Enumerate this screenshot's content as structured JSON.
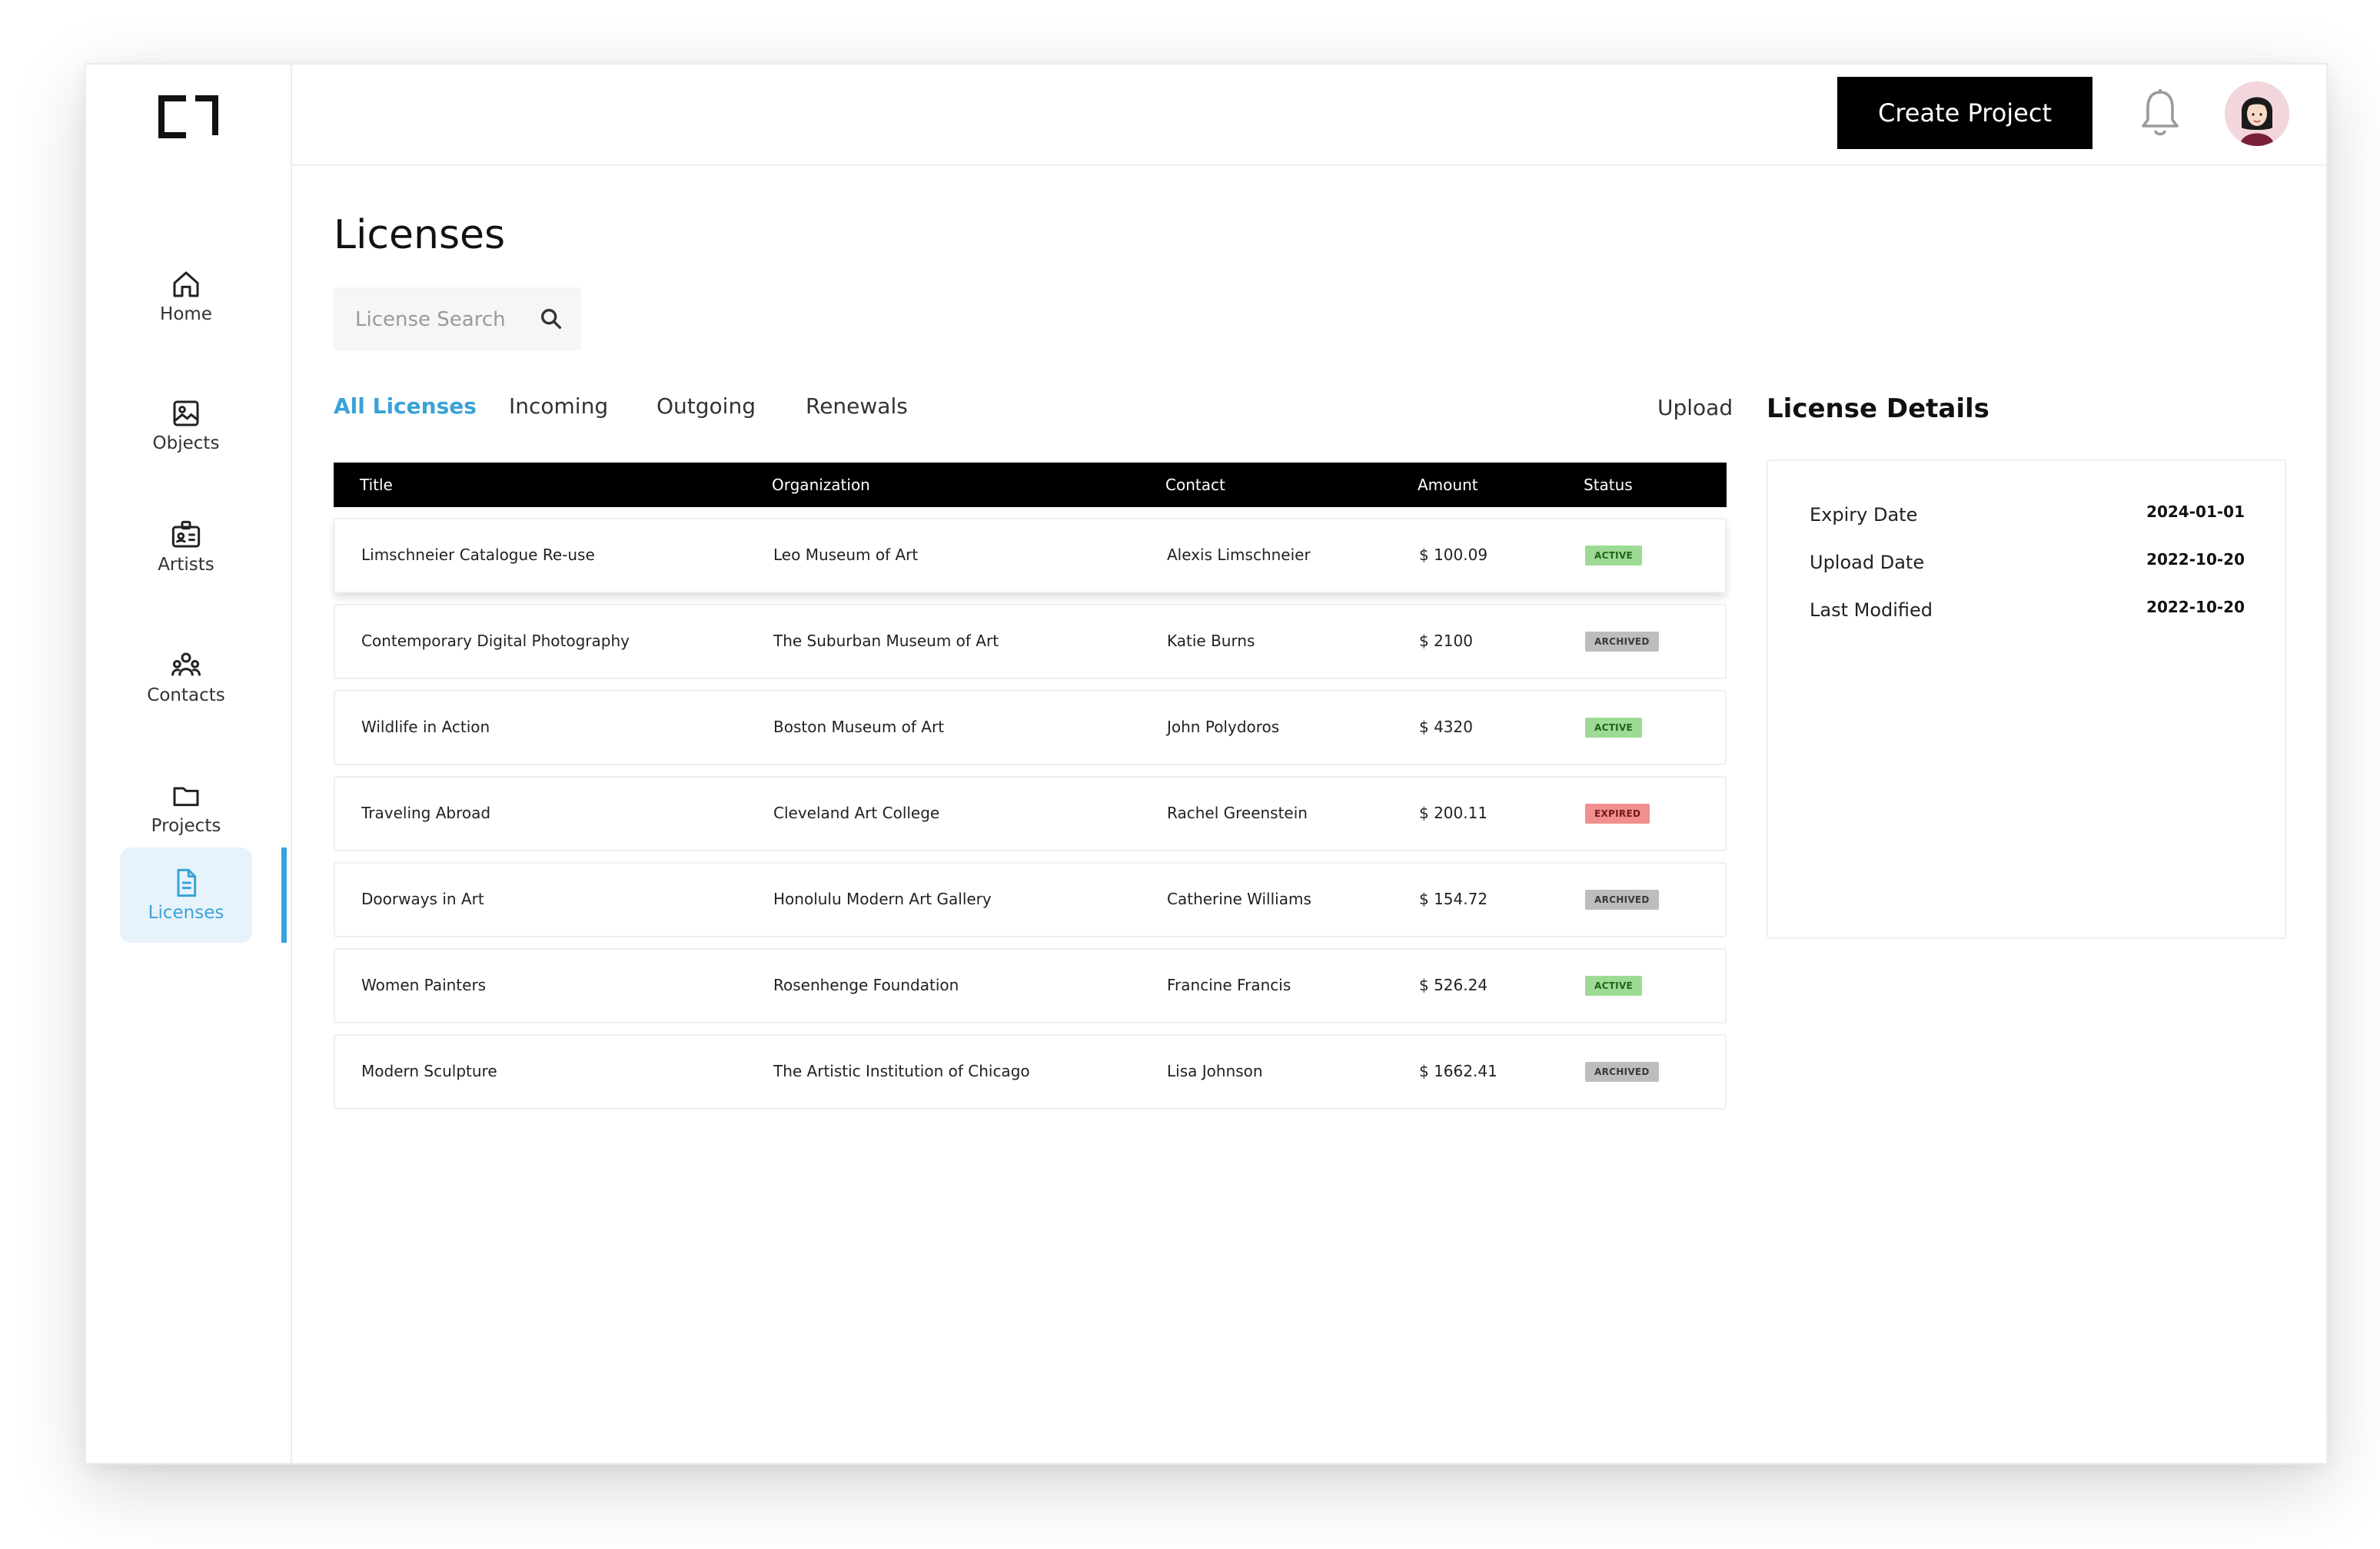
{
  "sidebar": {
    "items": [
      {
        "label": "Home",
        "icon": "home-icon"
      },
      {
        "label": "Objects",
        "icon": "image-icon"
      },
      {
        "label": "Artists",
        "icon": "id-card-icon"
      },
      {
        "label": "Contacts",
        "icon": "users-icon"
      },
      {
        "label": "Projects",
        "icon": "folder-icon"
      },
      {
        "label": "Licenses",
        "icon": "document-icon",
        "active": true
      }
    ]
  },
  "header": {
    "create_label": "Create Project"
  },
  "main": {
    "title": "Licenses",
    "search": {
      "placeholder": "License Search"
    },
    "tabs": [
      {
        "label": "All Licenses",
        "active": true
      },
      {
        "label": "Incoming"
      },
      {
        "label": "Outgoing"
      },
      {
        "label": "Renewals"
      }
    ],
    "upload_label": "Upload",
    "table": {
      "columns": [
        "Title",
        "Organization",
        "Contact",
        "Amount",
        "Status"
      ],
      "rows": [
        {
          "title": "Limschneier Catalogue Re-use",
          "org": "Leo Museum of Art",
          "contact": "Alexis Limschneier",
          "amount": "$ 100.09",
          "status": "ACTIVE"
        },
        {
          "title": "Contemporary Digital Photography",
          "org": "The Suburban Museum of Art",
          "contact": "Katie Burns",
          "amount": "$ 2100",
          "status": "ARCHIVED"
        },
        {
          "title": "Wildlife in Action",
          "org": "Boston Museum of Art",
          "contact": "John Polydoros",
          "amount": "$ 4320",
          "status": "ACTIVE"
        },
        {
          "title": "Traveling Abroad",
          "org": "Cleveland Art College",
          "contact": "Rachel Greenstein",
          "amount": "$ 200.11",
          "status": "EXPIRED"
        },
        {
          "title": "Doorways in Art",
          "org": "Honolulu Modern Art Gallery",
          "contact": "Catherine Williams",
          "amount": "$ 154.72",
          "status": "ARCHIVED"
        },
        {
          "title": "Women Painters",
          "org": "Rosenhenge Foundation",
          "contact": "Francine Francis",
          "amount": "$ 526.24",
          "status": "ACTIVE"
        },
        {
          "title": "Modern Sculpture",
          "org": "The Artistic Institution of Chicago",
          "contact": "Lisa Johnson",
          "amount": "$ 1662.41",
          "status": "ARCHIVED"
        }
      ]
    }
  },
  "details": {
    "title": "License Details",
    "fields": [
      {
        "label": "Expiry Date",
        "value": "2024-01-01"
      },
      {
        "label": "Upload Date",
        "value": "2022-10-20"
      },
      {
        "label": "Last Modified",
        "value": "2022-10-20"
      }
    ]
  },
  "colors": {
    "accent": "#3aa2d8",
    "active_badge": "#9ddb94",
    "archived_badge": "#bdbdbd",
    "expired_badge": "#ef8f8f"
  }
}
